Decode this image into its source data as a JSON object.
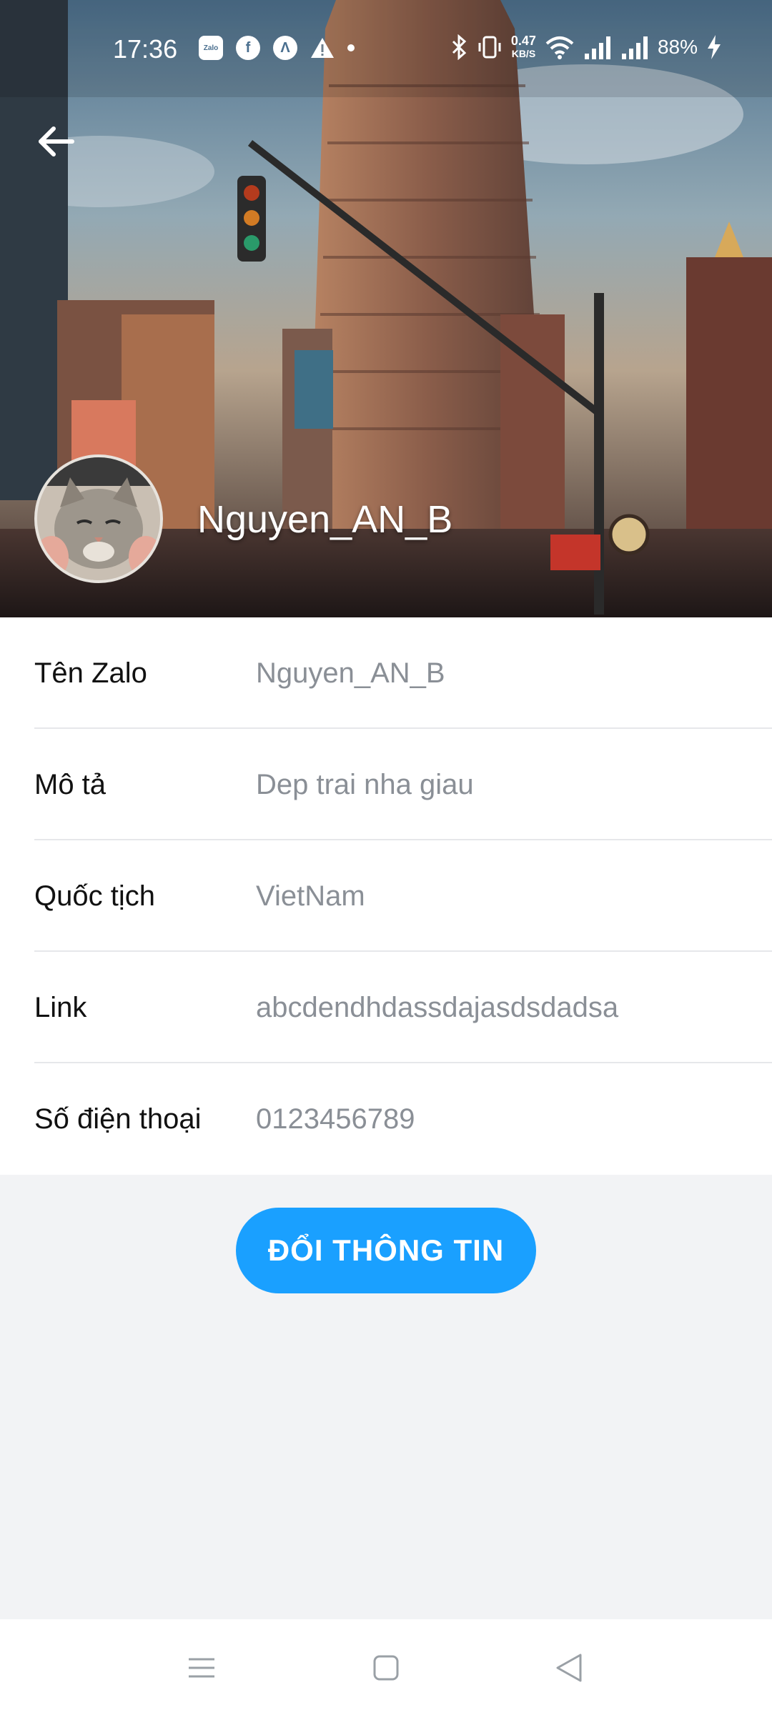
{
  "status_bar": {
    "time": "17:36",
    "notification_icons": [
      "zalo-icon",
      "facebook-icon",
      "app-icon",
      "warning-icon",
      "dot-icon"
    ],
    "zalo_label": "Zalo",
    "speed_value": "0.47",
    "speed_unit": "KB/S",
    "battery": "88%"
  },
  "profile": {
    "name": "Nguyen_AN_B",
    "back_icon": "arrow-left-icon"
  },
  "info_rows": [
    {
      "label": "Tên Zalo",
      "value": "Nguyen_AN_B"
    },
    {
      "label": "Mô tả",
      "value": "Dep trai nha giau"
    },
    {
      "label": "Quốc tịch",
      "value": "VietNam"
    },
    {
      "label": "Link",
      "value": "abcdendhdassdajasdsdadsa"
    },
    {
      "label": "Số điện thoại",
      "value": "0123456789"
    }
  ],
  "action": {
    "label": "ĐỔI THÔNG TIN"
  },
  "colors": {
    "accent": "#1aa0ff",
    "label_text": "#111111",
    "value_text": "#8a8f96",
    "background": "#f2f3f5"
  },
  "nav_bar": [
    "menu-icon",
    "home-square-icon",
    "back-triangle-icon"
  ]
}
